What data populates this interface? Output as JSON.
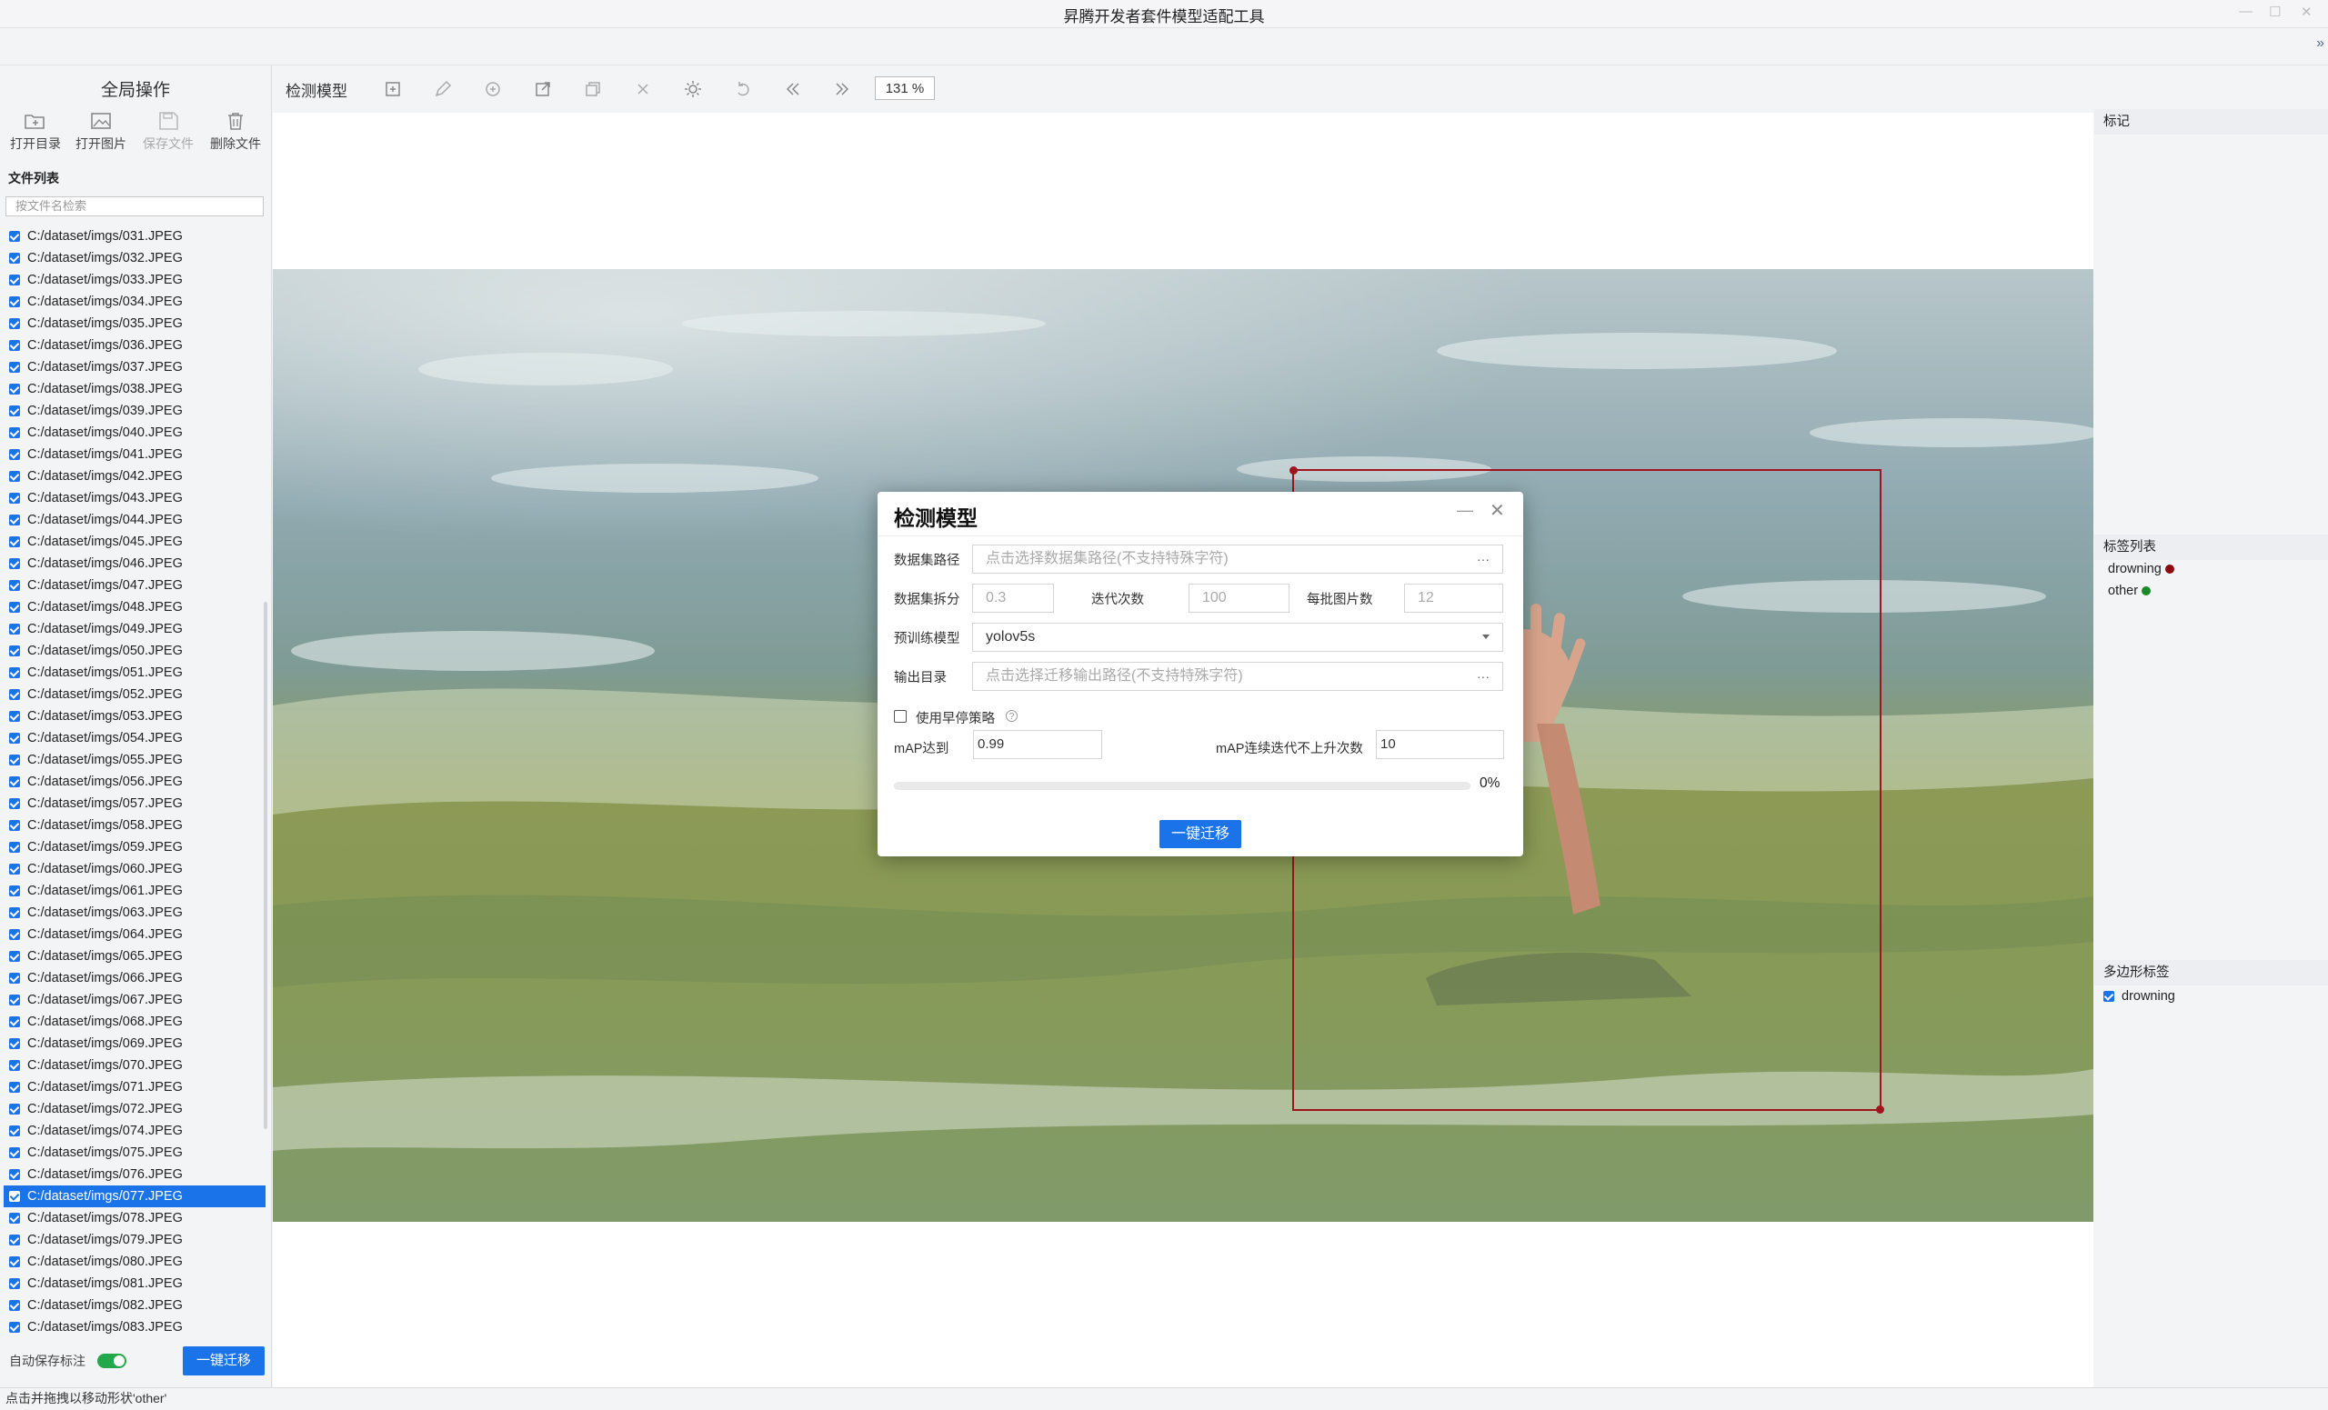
{
  "window": {
    "title": "昇腾开发者套件模型适配工具"
  },
  "left_panel": {
    "title": "全局操作",
    "buttons": [
      {
        "label": "打开目录",
        "icon": "folder-open-icon",
        "enabled": true
      },
      {
        "label": "打开图片",
        "icon": "image-icon",
        "enabled": true
      },
      {
        "label": "保存文件",
        "icon": "save-icon",
        "enabled": false
      },
      {
        "label": "删除文件",
        "icon": "trash-icon",
        "enabled": true
      }
    ],
    "file_list_label": "文件列表",
    "search_placeholder": "按文件名检索",
    "files": [
      "C:/dataset/imgs/031.JPEG",
      "C:/dataset/imgs/032.JPEG",
      "C:/dataset/imgs/033.JPEG",
      "C:/dataset/imgs/034.JPEG",
      "C:/dataset/imgs/035.JPEG",
      "C:/dataset/imgs/036.JPEG",
      "C:/dataset/imgs/037.JPEG",
      "C:/dataset/imgs/038.JPEG",
      "C:/dataset/imgs/039.JPEG",
      "C:/dataset/imgs/040.JPEG",
      "C:/dataset/imgs/041.JPEG",
      "C:/dataset/imgs/042.JPEG",
      "C:/dataset/imgs/043.JPEG",
      "C:/dataset/imgs/044.JPEG",
      "C:/dataset/imgs/045.JPEG",
      "C:/dataset/imgs/046.JPEG",
      "C:/dataset/imgs/047.JPEG",
      "C:/dataset/imgs/048.JPEG",
      "C:/dataset/imgs/049.JPEG",
      "C:/dataset/imgs/050.JPEG",
      "C:/dataset/imgs/051.JPEG",
      "C:/dataset/imgs/052.JPEG",
      "C:/dataset/imgs/053.JPEG",
      "C:/dataset/imgs/054.JPEG",
      "C:/dataset/imgs/055.JPEG",
      "C:/dataset/imgs/056.JPEG",
      "C:/dataset/imgs/057.JPEG",
      "C:/dataset/imgs/058.JPEG",
      "C:/dataset/imgs/059.JPEG",
      "C:/dataset/imgs/060.JPEG",
      "C:/dataset/imgs/061.JPEG",
      "C:/dataset/imgs/063.JPEG",
      "C:/dataset/imgs/064.JPEG",
      "C:/dataset/imgs/065.JPEG",
      "C:/dataset/imgs/066.JPEG",
      "C:/dataset/imgs/067.JPEG",
      "C:/dataset/imgs/068.JPEG",
      "C:/dataset/imgs/069.JPEG",
      "C:/dataset/imgs/070.JPEG",
      "C:/dataset/imgs/071.JPEG",
      "C:/dataset/imgs/072.JPEG",
      "C:/dataset/imgs/074.JPEG",
      "C:/dataset/imgs/075.JPEG",
      "C:/dataset/imgs/076.JPEG",
      "C:/dataset/imgs/077.JPEG",
      "C:/dataset/imgs/078.JPEG",
      "C:/dataset/imgs/079.JPEG",
      "C:/dataset/imgs/080.JPEG",
      "C:/dataset/imgs/081.JPEG",
      "C:/dataset/imgs/082.JPEG",
      "C:/dataset/imgs/083.JPEG"
    ],
    "selected_file": "C:/dataset/imgs/077.JPEG",
    "auto_save_label": "自动保存标注",
    "auto_save_on": true,
    "migrate_button": "一键迁移"
  },
  "toolbar": {
    "mode_label": "检测模型",
    "tools": [
      "add-box-icon",
      "edit-icon",
      "add-circle-icon",
      "export-icon",
      "copy-icon",
      "close-icon",
      "brightness-icon",
      "undo-icon",
      "prev-icon",
      "next-icon"
    ],
    "zoom": "131 %"
  },
  "right_panel": {
    "marks_title": "标记",
    "labels_title": "标签列表",
    "labels": [
      {
        "name": "drowning",
        "color": "#8b0a10"
      },
      {
        "name": "other",
        "color": "#1a8a2a"
      }
    ],
    "polygon_title": "多边形标签",
    "polygon_labels": [
      "drowning"
    ]
  },
  "dialog": {
    "title": "检测模型",
    "dataset_path_label": "数据集路径",
    "dataset_path_placeholder": "点击选择数据集路径(不支持特殊字符)",
    "split_label": "数据集拆分",
    "split_placeholder": "0.3",
    "iterations_label": "迭代次数",
    "iterations_placeholder": "100",
    "batch_label": "每批图片数",
    "batch_placeholder": "12",
    "pretrained_label": "预训练模型",
    "pretrained_value": "yolov5s",
    "output_label": "输出目录",
    "output_placeholder": "点击选择迁移输出路径(不支持特殊字符)",
    "early_stop_label": "使用早停策略",
    "early_stop_checked": false,
    "map_label": "mAP达到",
    "map_value": "0.99",
    "map_patience_label": "mAP连续迭代不上升次数",
    "map_patience_value": "10",
    "progress": 0,
    "progress_text": "0%",
    "migrate_button": "一键迁移"
  },
  "status_bar": {
    "text": "点击并拖拽以移动形状'other'"
  }
}
